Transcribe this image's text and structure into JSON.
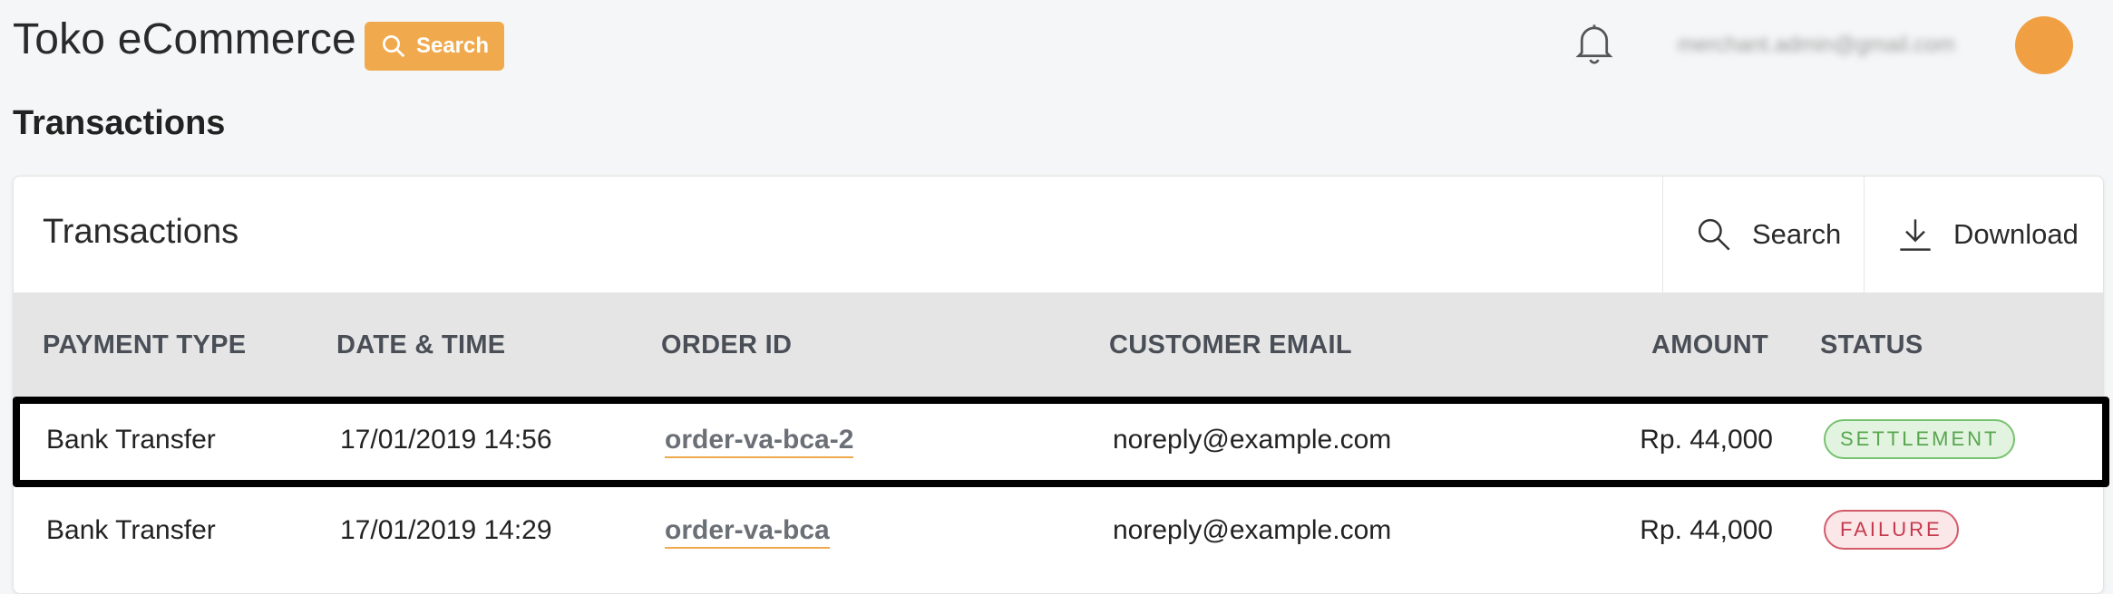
{
  "header": {
    "app_title": "Toko eCommerce",
    "search_label": "Search",
    "user_email": "merchant.admin@gmail.com",
    "accent_color": "#f0aa4d"
  },
  "page": {
    "title": "Transactions"
  },
  "card": {
    "title": "Transactions",
    "search_label": "Search",
    "download_label": "Download"
  },
  "table": {
    "columns": [
      "PAYMENT TYPE",
      "DATE & TIME",
      "ORDER ID",
      "CUSTOMER EMAIL",
      "AMOUNT",
      "STATUS"
    ],
    "rows": [
      {
        "payment_type": "Bank Transfer",
        "datetime": "17/01/2019 14:56",
        "order_id": "order-va-bca-2",
        "email": "noreply@example.com",
        "amount": "Rp. 44,000",
        "status": "SETTLEMENT",
        "status_color": "#58a64f",
        "highlighted": true
      },
      {
        "payment_type": "Bank Transfer",
        "datetime": "17/01/2019 14:29",
        "order_id": "order-va-bca",
        "email": "noreply@example.com",
        "amount": "Rp. 44,000",
        "status": "FAILURE",
        "status_color": "#c6394c",
        "highlighted": false
      }
    ]
  },
  "icons": [
    "search-icon",
    "bell-icon",
    "download-icon"
  ]
}
